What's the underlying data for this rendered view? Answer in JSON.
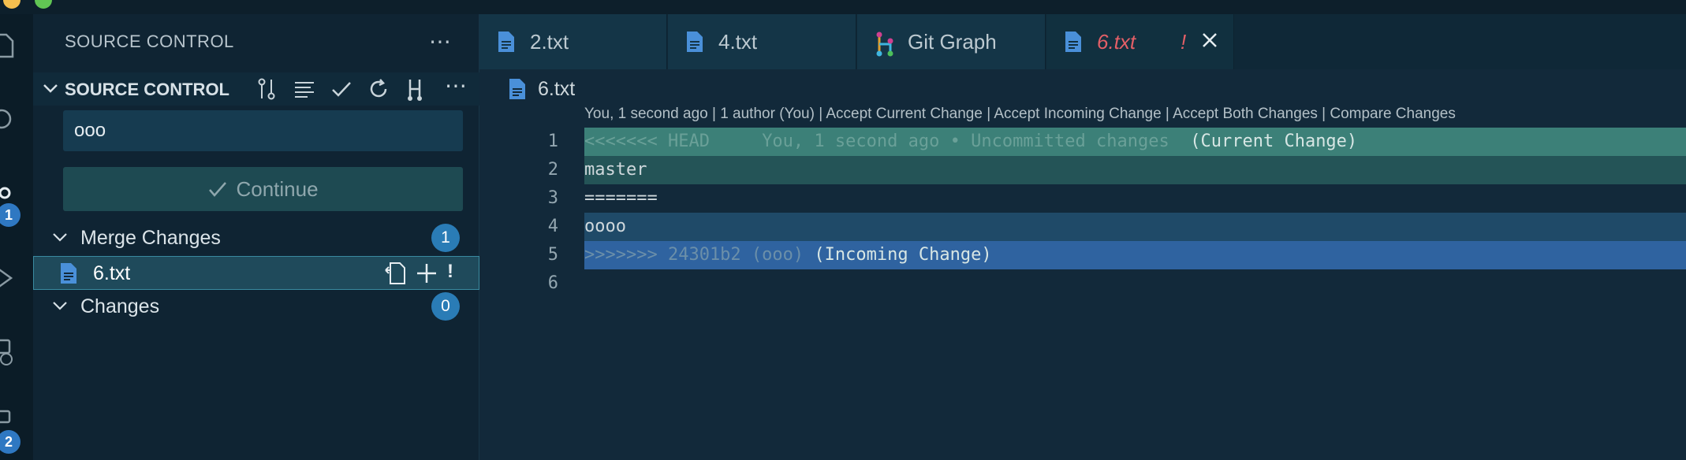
{
  "sidebar": {
    "title": "SOURCE CONTROL",
    "section_title": "SOURCE CONTROL",
    "commit_message": "ooo",
    "continue_label": "Continue",
    "merge_group": {
      "label": "Merge Changes",
      "count": "1"
    },
    "merge_file": {
      "name": "6.txt",
      "status": "!"
    },
    "changes_group": {
      "label": "Changes",
      "count": "0"
    }
  },
  "activity": {
    "scm_badge": "1",
    "extensions_badge": "2"
  },
  "tabs": [
    {
      "label": "2.txt"
    },
    {
      "label": "4.txt"
    },
    {
      "label": "Git Graph"
    },
    {
      "label": "6.txt",
      "status": "!"
    }
  ],
  "editor": {
    "breadcrumb_file": "6.txt",
    "codelens": "You, 1 second ago | 1 author (You) | Accept Current Change | Accept Incoming Change | Accept Both Changes | Compare Changes",
    "lines": [
      {
        "num": "1",
        "marker": "<<<<<<< HEAD",
        "blame": "You, 1 second ago • Uncommitted changes",
        "hint": "(Current Change)"
      },
      {
        "num": "2",
        "text": "master"
      },
      {
        "num": "3",
        "text": "======="
      },
      {
        "num": "4",
        "text": "oooo"
      },
      {
        "num": "5",
        "marker": ">>>>>>> 24301b2 (ooo)",
        "hint": "(Incoming Change)"
      },
      {
        "num": "6",
        "text": ""
      }
    ]
  },
  "colors": {
    "current_header": "#3c8078",
    "current_body": "#245457",
    "incoming_body": "#1f4a68",
    "incoming_header": "#2f63a0",
    "badge": "#2f78c2",
    "modified_tab": "#e35f67"
  }
}
